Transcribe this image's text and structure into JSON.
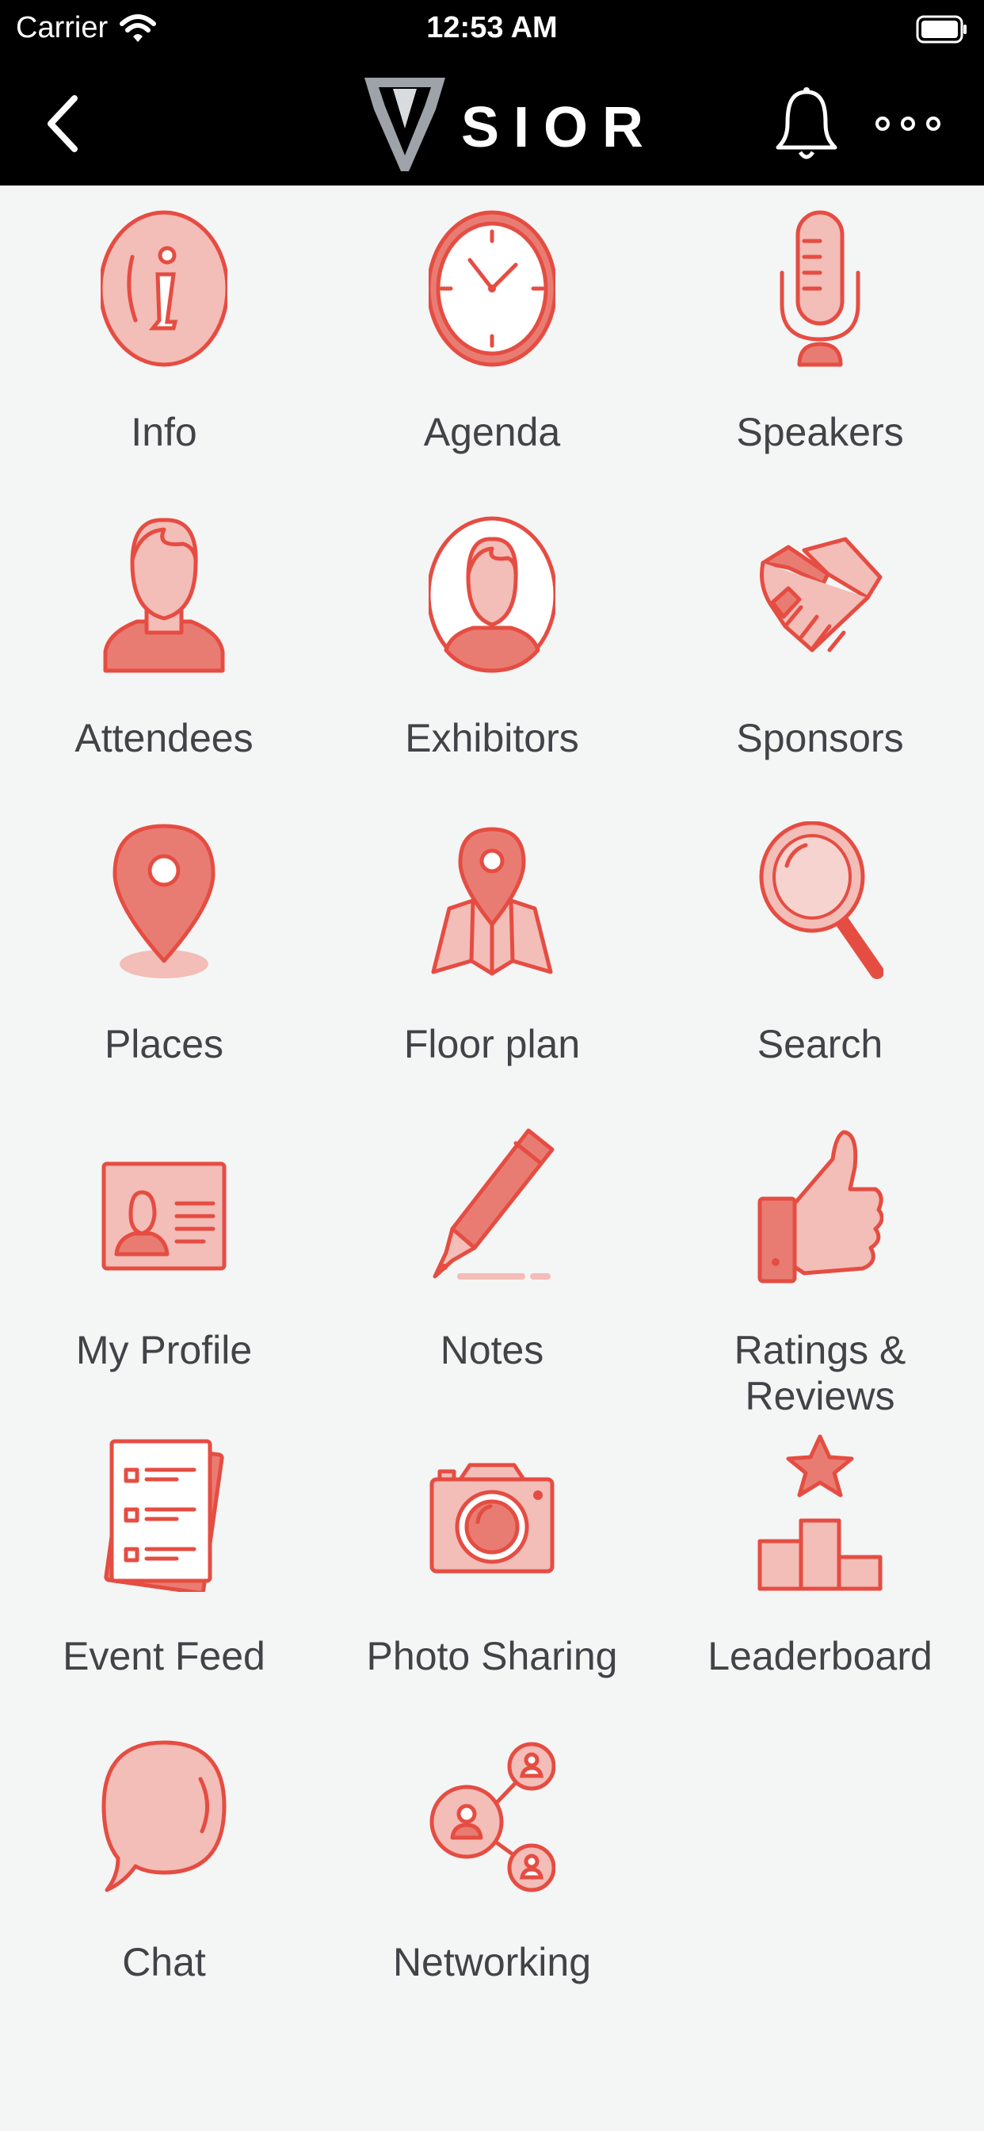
{
  "status_bar": {
    "carrier": "Carrier",
    "time": "12:53 AM"
  },
  "header": {
    "logo_text": "SIOR",
    "icons": [
      "chevron-left-icon",
      "bell-icon",
      "more-horizontal-icon"
    ]
  },
  "accent_color": "#e54d42",
  "tiles": [
    {
      "label": "Info",
      "icon": "info-icon"
    },
    {
      "label": "Agenda",
      "icon": "clock-icon"
    },
    {
      "label": "Speakers",
      "icon": "microphone-icon"
    },
    {
      "label": "Attendees",
      "icon": "person-icon"
    },
    {
      "label": "Exhibitors",
      "icon": "person-circle-icon"
    },
    {
      "label": "Sponsors",
      "icon": "handshake-icon"
    },
    {
      "label": "Places",
      "icon": "map-pin-icon"
    },
    {
      "label": "Floor plan",
      "icon": "map-icon"
    },
    {
      "label": "Search",
      "icon": "magnifier-icon"
    },
    {
      "label": "My Profile",
      "icon": "id-card-icon"
    },
    {
      "label": "Notes",
      "icon": "pen-icon"
    },
    {
      "label": "Ratings & Reviews",
      "icon": "thumbs-up-icon"
    },
    {
      "label": "Event Feed",
      "icon": "checklist-icon"
    },
    {
      "label": "Photo Sharing",
      "icon": "camera-icon"
    },
    {
      "label": "Leaderboard",
      "icon": "podium-star-icon"
    },
    {
      "label": "Chat",
      "icon": "speech-bubble-icon"
    },
    {
      "label": "Networking",
      "icon": "network-people-icon"
    }
  ]
}
